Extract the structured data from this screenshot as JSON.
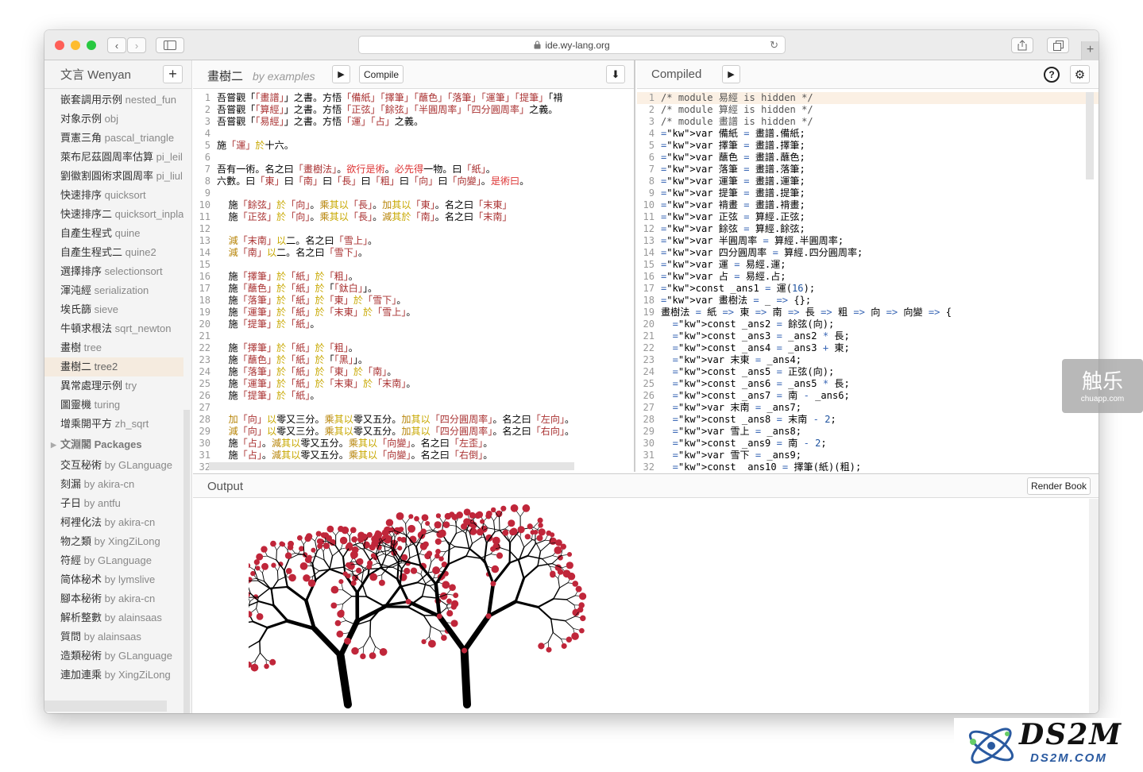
{
  "browser": {
    "url": "ide.wy-lang.org"
  },
  "sidebar": {
    "title": "文言 Wenyan",
    "add": "+",
    "examples": [
      {
        "zh": "嵌套調用示例",
        "en": "nested_fun"
      },
      {
        "zh": "对象示例",
        "en": "obj"
      },
      {
        "zh": "賈憲三角",
        "en": "pascal_triangle"
      },
      {
        "zh": "萊布尼茲圓周率估算",
        "en": "pi_leil"
      },
      {
        "zh": "劉徽割圓術求圓周率",
        "en": "pi_liul"
      },
      {
        "zh": "快速排序",
        "en": "quicksort"
      },
      {
        "zh": "快速排序二",
        "en": "quicksort_inpla"
      },
      {
        "zh": "自產生程式",
        "en": "quine"
      },
      {
        "zh": "自產生程式二",
        "en": "quine2"
      },
      {
        "zh": "選擇排序",
        "en": "selectionsort"
      },
      {
        "zh": "渾沌經",
        "en": "serialization"
      },
      {
        "zh": "埃氏篩",
        "en": "sieve"
      },
      {
        "zh": "牛頓求根法",
        "en": "sqrt_newton"
      },
      {
        "zh": "畫樹",
        "en": "tree"
      },
      {
        "zh": "畫樹二",
        "en": "tree2"
      },
      {
        "zh": "異常處理示例",
        "en": "try"
      },
      {
        "zh": "圖靈機",
        "en": "turing"
      },
      {
        "zh": "增乘開平方",
        "en": "zh_sqrt"
      }
    ],
    "packages_title": "文淵閣 Packages",
    "packages": [
      {
        "zh": "交互秘術",
        "en": "by GLanguage"
      },
      {
        "zh": "刻漏",
        "en": "by akira-cn"
      },
      {
        "zh": "子日",
        "en": "by antfu"
      },
      {
        "zh": "柯裡化法",
        "en": "by akira-cn"
      },
      {
        "zh": "物之類",
        "en": "by XingZiLong"
      },
      {
        "zh": "符經",
        "en": "by GLanguage"
      },
      {
        "zh": "简体秘术",
        "en": "by lymslive"
      },
      {
        "zh": "腳本秘術",
        "en": "by akira-cn"
      },
      {
        "zh": "解析整數",
        "en": "by alainsaas"
      },
      {
        "zh": "質問",
        "en": "by alainsaas"
      },
      {
        "zh": "造類秘術",
        "en": "by GLanguage"
      },
      {
        "zh": "連加連乘",
        "en": "by XingZiLong"
      }
    ]
  },
  "editor": {
    "title": "畫樹二",
    "subtitle": "by examples",
    "run": "▶",
    "compile": "Compile",
    "download": "⬇",
    "lines": [
      "吾嘗觀「「畫譜」」之書。方悟「備紙」「擇筆」「蘸色」「落筆」「運筆」「提筆」「褙",
      "吾嘗觀「「算經」」之書。方悟「正弦」「餘弦」「半圓周率」「四分圓周率」之義。",
      "吾嘗觀「「易經」」之書。方悟「運」「占」之義。",
      "",
      "施「運」於十六。",
      "",
      "吾有一術。名之曰「畫樹法」。欲行是術。必先得一物。曰「紙」。",
      "六數。曰「東」曰「南」曰「長」曰「粗」曰「向」曰「向變」。是術曰。",
      "",
      "  施「餘弦」於「向」。乘其以「長」。加其以「東」。名之曰「末東」",
      "  施「正弦」於「向」。乘其以「長」。減其於「南」。名之曰「末南」",
      "",
      "  減「末南」以二。名之曰「雪上」。",
      "  減「南」以二。名之曰「雪下」。",
      "",
      "  施「擇筆」於「紙」於「粗」。",
      "  施「蘸色」於「紙」於「「鈦白」」。",
      "  施「落筆」於「紙」於「東」於「雪下」。",
      "  施「運筆」於「紙」於「末東」於「雪上」。",
      "  施「提筆」於「紙」。",
      "",
      "  施「擇筆」於「紙」於「粗」。",
      "  施「蘸色」於「紙」於「「黑」」。",
      "  施「落筆」於「紙」於「東」於「南」。",
      "  施「運筆」於「紙」於「末東」於「末南」。",
      "  施「提筆」於「紙」。",
      "",
      "  加「向」以零又三分。乘其以零又五分。加其以「四分圓周率」。名之曰「左向」。",
      "  減「向」以零又三分。乘其以零又五分。加其以「四分圓周率」。名之曰「右向」。",
      "  施「占」。減其以零又五分。乘其以「向變」。名之曰「左歪」。",
      "  施「占」。減其以零又五分。乘其以「向變」。名之曰「右倒」。",
      ""
    ]
  },
  "compiled": {
    "title": "Compiled",
    "run": "▶",
    "help": "?",
    "settings": "⚙",
    "lines": [
      "/* module 易經 is hidden */",
      "/* module 算經 is hidden */",
      "/* module 畫譜 is hidden */",
      "var 備紙 = 畫譜.備紙;",
      "var 擇筆 = 畫譜.擇筆;",
      "var 蘸色 = 畫譜.蘸色;",
      "var 落筆 = 畫譜.落筆;",
      "var 運筆 = 畫譜.運筆;",
      "var 提筆 = 畫譜.提筆;",
      "var 褙畫 = 畫譜.褙畫;",
      "var 正弦 = 算經.正弦;",
      "var 餘弦 = 算經.餘弦;",
      "var 半圓周率 = 算經.半圓周率;",
      "var 四分圓周率 = 算經.四分圓周率;",
      "var 運 = 易經.運;",
      "var 占 = 易經.占;",
      "const _ans1 = 運(16);",
      "var 畫樹法 = _ => {};",
      "畫樹法 = 紙 => 東 => 南 => 長 => 粗 => 向 => 向變 => {",
      "  const _ans2 = 餘弦(向);",
      "  const _ans3 = _ans2 * 長;",
      "  const _ans4 = _ans3 + 東;",
      "  var 末東 = _ans4;",
      "  const _ans5 = 正弦(向);",
      "  const _ans6 = _ans5 * 長;",
      "  const _ans7 = 南 - _ans6;",
      "  var 末南 = _ans7;",
      "  const _ans8 = 末南 - 2;",
      "  var 雪上 = _ans8;",
      "  const _ans9 = 南 - 2;",
      "  var 雪下 = _ans9;",
      "  const _ans10 = 擇筆(紙)(粗);"
    ]
  },
  "output": {
    "title": "Output",
    "render_book": "Render Book"
  },
  "watermarks": {
    "chuapp_main": "触乐",
    "chuapp_sub": "chuapp.com",
    "ds2m_main": "DS2M",
    "ds2m_sub": "DS2M.COM"
  }
}
